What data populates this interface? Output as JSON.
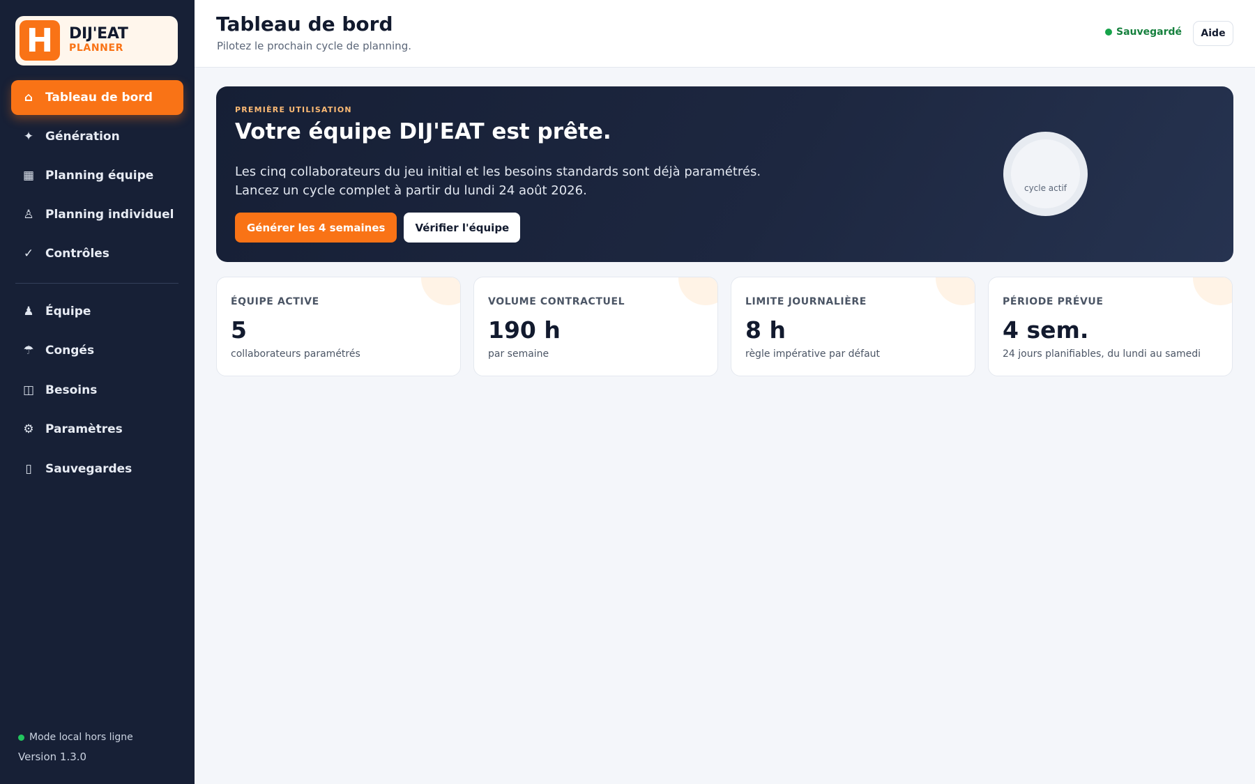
{
  "brand": {
    "logo_letter": "H",
    "name": "DIJ'EAT",
    "sub": "PLANNER"
  },
  "sidebar": {
    "items": [
      {
        "label": "Tableau de bord",
        "icon": "home-icon",
        "glyph": "⌂",
        "active": true
      },
      {
        "label": "Génération",
        "icon": "sparkle-icon",
        "glyph": "✦"
      },
      {
        "label": "Planning équipe",
        "icon": "grid-icon",
        "glyph": "▦"
      },
      {
        "label": "Planning individuel",
        "icon": "person-icon",
        "glyph": "♙"
      },
      {
        "label": "Contrôles",
        "icon": "check-icon",
        "glyph": "✓"
      },
      {
        "label": "Équipe",
        "icon": "team-icon",
        "glyph": "♟"
      },
      {
        "label": "Congés",
        "icon": "umbrella-icon",
        "glyph": "☂"
      },
      {
        "label": "Besoins",
        "icon": "columns-icon",
        "glyph": "◫"
      },
      {
        "label": "Paramètres",
        "icon": "gear-icon",
        "glyph": "⚙"
      },
      {
        "label": "Sauvegardes",
        "icon": "backup-icon",
        "glyph": "▯"
      }
    ],
    "status": "Mode local hors ligne",
    "version": "Version 1.3.0"
  },
  "header": {
    "title": "Tableau de bord",
    "subtitle": "Pilotez le prochain cycle de planning.",
    "saved": "Sauvegardé",
    "help": "Aide"
  },
  "hero": {
    "eyebrow": "PREMIÈRE UTILISATION",
    "title": "Votre équipe DIJ'EAT est prête.",
    "line1": "Les cinq collaborateurs du jeu initial et les besoins standards sont déjà paramétrés.",
    "line2": "Lancez un cycle complet à partir du lundi 24 août 2026.",
    "primary_button": "Générer les 4 semaines",
    "secondary_button": "Vérifier l'équipe",
    "cycle_label": "cycle actif"
  },
  "stats": [
    {
      "label": "ÉQUIPE ACTIVE",
      "value": "5",
      "desc": "collaborateurs paramétrés"
    },
    {
      "label": "VOLUME CONTRACTUEL",
      "value": "190 h",
      "desc": "par semaine"
    },
    {
      "label": "LIMITE JOURNALIÈRE",
      "value": "8 h",
      "desc": "règle impérative par défaut"
    },
    {
      "label": "PÉRIODE PRÉVUE",
      "value": "4 sem.",
      "desc": "24 jours planifiables, du lundi au samedi"
    }
  ],
  "colors": {
    "accent": "#f97316",
    "sidebar": "#172036",
    "success": "#16a34a"
  }
}
